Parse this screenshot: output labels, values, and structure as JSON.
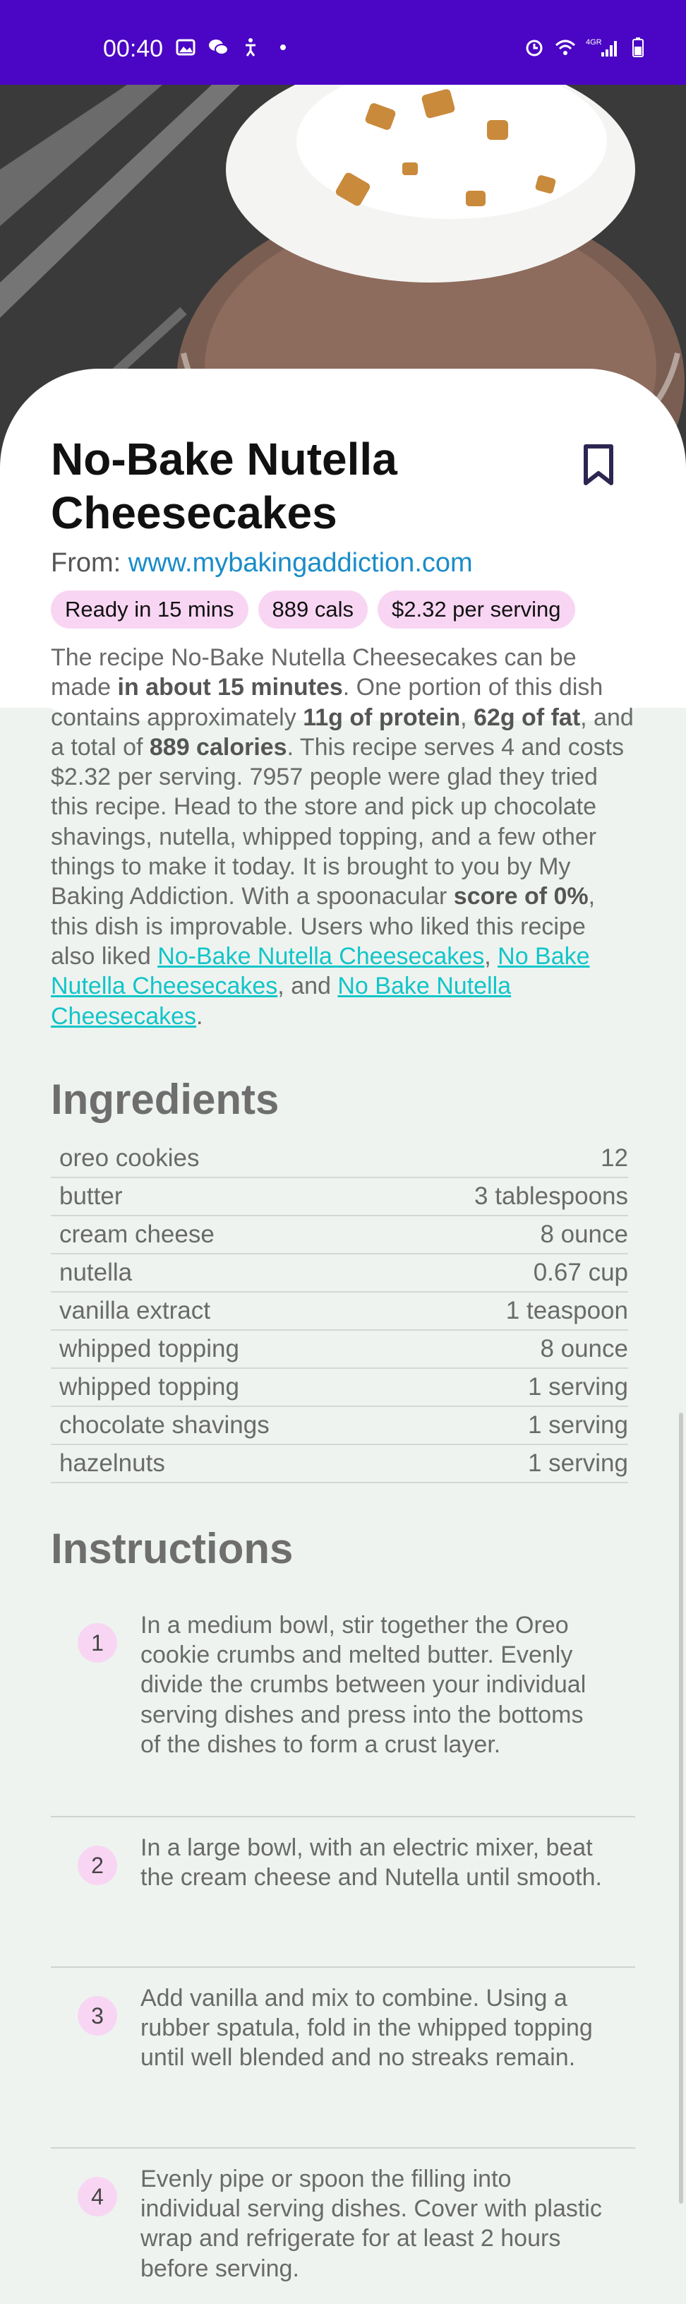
{
  "status_bar": {
    "time": "00:40",
    "left_icons": [
      "image-icon",
      "chat-icon",
      "accessibility-icon",
      "dot-icon"
    ],
    "right_icons": [
      "alarm-icon",
      "wifi-icon",
      "signal-icon",
      "battery-icon"
    ],
    "network": "4GR"
  },
  "recipe": {
    "title": "No-Bake Nutella Cheesecakes",
    "source_prefix": "From: ",
    "source_url": "www.mybakingaddiction.com",
    "chips": [
      "Ready in 15 mins",
      "889 cals",
      "$2.32 per serving"
    ],
    "summary": {
      "p1": "The recipe No-Bake Nutella Cheesecakes can be made ",
      "b1": "in about 15 minutes",
      "p2": ". One portion of this dish contains approximately ",
      "b2": "11g of protein",
      "p3": ", ",
      "b3": "62g of fat",
      "p4": ", and a total of ",
      "b4": "889 calories",
      "p5": ". This recipe serves 4 and costs $2.32 per serving. 7957 people were glad they tried this recipe. Head to the store and pick up chocolate shavings, nutella, whipped topping, and a few other things to make it today. It is brought to you by My Baking Addiction. With a spoonacular ",
      "b5": "score of 0%",
      "p6": ", this dish is improvable. Users who liked this recipe also liked ",
      "link1": "No-Bake Nutella Cheesecakes",
      "p7": ", ",
      "link2": "No Bake Nutella Cheesecakes",
      "p8": ", and ",
      "link3": "No Bake Nutella Cheesecakes",
      "p9": "."
    }
  },
  "ingredients": {
    "title": "Ingredients",
    "rows": [
      {
        "name": "oreo cookies",
        "amount": "12"
      },
      {
        "name": "butter",
        "amount": "3 tablespoons"
      },
      {
        "name": "cream cheese",
        "amount": "8 ounce"
      },
      {
        "name": "nutella",
        "amount": "0.67 cup"
      },
      {
        "name": "vanilla extract",
        "amount": "1 teaspoon"
      },
      {
        "name": "whipped topping",
        "amount": "8 ounce"
      },
      {
        "name": "whipped topping",
        "amount": "1 serving"
      },
      {
        "name": "chocolate shavings",
        "amount": "1 serving"
      },
      {
        "name": "hazelnuts",
        "amount": "1 serving"
      }
    ]
  },
  "instructions": {
    "title": "Instructions",
    "steps": [
      {
        "number": "1",
        "text": "In a medium bowl, stir together the Oreo cookie crumbs and melted butter. Evenly divide the crumbs between your individual serving dishes and press into the bottoms of the dishes to form a crust layer."
      },
      {
        "number": "2",
        "text": "In a large bowl, with an electric mixer, beat the cream cheese and Nutella until smooth."
      },
      {
        "number": "3",
        "text": "Add vanilla and mix to combine. Using a rubber spatula, fold in the whipped topping until well blended and no streaks remain."
      },
      {
        "number": "4",
        "text": "Evenly pipe or spoon the filling into individual serving dishes. Cover with plastic wrap and refrigerate for at least 2 hours before serving."
      }
    ]
  },
  "colors": {
    "status_bar": "#4a06c4",
    "chip_bg": "#f8d6f3",
    "link": "#12c5c9",
    "source_link": "#1a8cc8"
  }
}
